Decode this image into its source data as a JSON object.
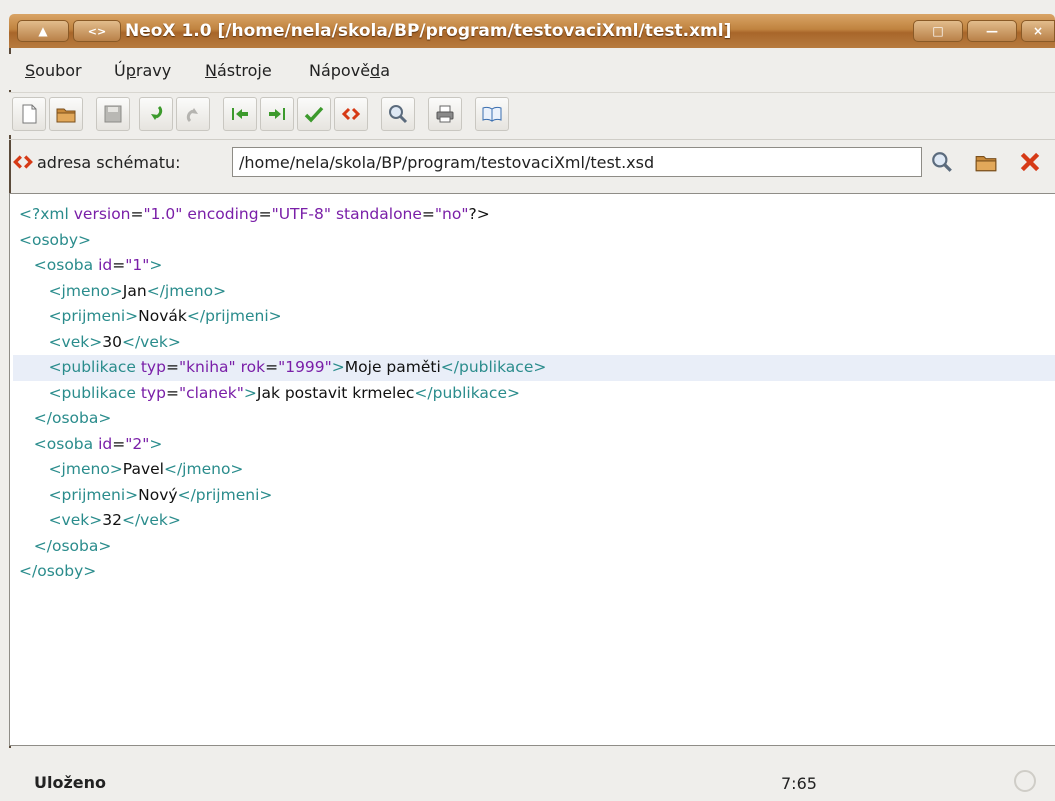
{
  "window": {
    "title": "NeoX 1.0 [/home/nela/skola/BP/program/testovaciXml/test.xml]"
  },
  "menu": {
    "items": [
      {
        "label": "Soubor"
      },
      {
        "label": "Úpravy"
      },
      {
        "label": "Nástroje"
      },
      {
        "label": "Nápověda"
      }
    ]
  },
  "toolbar": {
    "buttons": [
      "new-file-icon",
      "open-folder-icon",
      "save-icon",
      "undo-icon",
      "redo-icon",
      "indent-left-icon",
      "indent-right-icon",
      "validate-check-icon",
      "xml-tag-icon",
      "search-icon",
      "print-icon",
      "help-book-icon"
    ]
  },
  "schema": {
    "label": "adresa schématu:",
    "path": "/home/nela/skola/BP/program/testovaciXml/test.xsd"
  },
  "editor": {
    "lines": [
      [
        [
          "t",
          "<?xml "
        ],
        [
          "a",
          "version"
        ],
        [
          "x",
          "="
        ],
        [
          "v",
          "\"1.0\""
        ],
        [
          "x",
          " "
        ],
        [
          "a",
          "encoding"
        ],
        [
          "x",
          "="
        ],
        [
          "v",
          "\"UTF-8\""
        ],
        [
          "x",
          " "
        ],
        [
          "a",
          "standalone"
        ],
        [
          "x",
          "="
        ],
        [
          "v",
          "\"no\""
        ],
        [
          "x",
          "?>"
        ]
      ],
      [
        [
          "t",
          "<osoby>"
        ]
      ],
      [
        [
          "x",
          "   "
        ],
        [
          "t",
          "<osoba "
        ],
        [
          "a",
          "id"
        ],
        [
          "x",
          "="
        ],
        [
          "v",
          "\"1\""
        ],
        [
          "t",
          ">"
        ]
      ],
      [
        [
          "x",
          "      "
        ],
        [
          "t",
          "<jmeno>"
        ],
        [
          "x",
          "Jan"
        ],
        [
          "t",
          "</jmeno>"
        ]
      ],
      [
        [
          "x",
          "      "
        ],
        [
          "t",
          "<prijmeni>"
        ],
        [
          "x",
          "Novák"
        ],
        [
          "t",
          "</prijmeni>"
        ]
      ],
      [
        [
          "x",
          "      "
        ],
        [
          "t",
          "<vek>"
        ],
        [
          "x",
          "30"
        ],
        [
          "t",
          "</vek>"
        ]
      ],
      [
        [
          "x",
          "      "
        ],
        [
          "t",
          "<publikace "
        ],
        [
          "a",
          "typ"
        ],
        [
          "x",
          "="
        ],
        [
          "v",
          "\"kniha\""
        ],
        [
          "x",
          " "
        ],
        [
          "a",
          "rok"
        ],
        [
          "x",
          "="
        ],
        [
          "v",
          "\"1999\""
        ],
        [
          "t",
          ">"
        ],
        [
          "x",
          "Moje paměti"
        ],
        [
          "t",
          "</publikace>"
        ]
      ],
      [
        [
          "x",
          "      "
        ],
        [
          "t",
          "<publikace "
        ],
        [
          "a",
          "typ"
        ],
        [
          "x",
          "="
        ],
        [
          "v",
          "\"clanek\""
        ],
        [
          "t",
          ">"
        ],
        [
          "x",
          "Jak postavit krmelec"
        ],
        [
          "t",
          "</publikace>"
        ]
      ],
      [
        [
          "x",
          "   "
        ],
        [
          "t",
          "</osoba>"
        ]
      ],
      [
        [
          "x",
          "   "
        ],
        [
          "t",
          "<osoba "
        ],
        [
          "a",
          "id"
        ],
        [
          "x",
          "="
        ],
        [
          "v",
          "\"2\""
        ],
        [
          "t",
          ">"
        ]
      ],
      [
        [
          "x",
          "      "
        ],
        [
          "t",
          "<jmeno>"
        ],
        [
          "x",
          "Pavel"
        ],
        [
          "t",
          "</jmeno>"
        ]
      ],
      [
        [
          "x",
          "      "
        ],
        [
          "t",
          "<prijmeni>"
        ],
        [
          "x",
          "Nový"
        ],
        [
          "t",
          "</prijmeni>"
        ]
      ],
      [
        [
          "x",
          "      "
        ],
        [
          "t",
          "<vek>"
        ],
        [
          "x",
          "32"
        ],
        [
          "t",
          "</vek>"
        ]
      ],
      [
        [
          "x",
          "   "
        ],
        [
          "t",
          "</osoba>"
        ]
      ],
      [
        [
          "t",
          "</osoby>"
        ]
      ]
    ],
    "highlighted_line": 6
  },
  "status": {
    "message": "Uloženo",
    "position": "7:65"
  },
  "colors": {
    "title_bar": "#c0833f",
    "tag": "#2a8c8c",
    "attribute": "#7a1fa8",
    "text": "#111111",
    "current_line": "#e9eef8",
    "close_red": "#d63a16"
  }
}
